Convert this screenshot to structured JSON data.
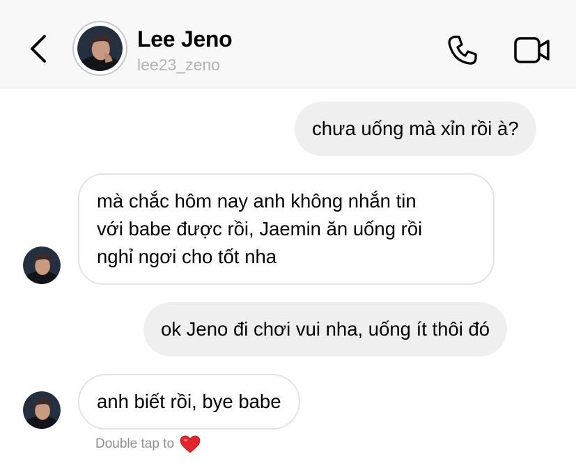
{
  "header": {
    "name": "Lee Jeno",
    "username": "lee23_zeno",
    "icons": [
      "back-icon",
      "phone-icon",
      "video-icon"
    ]
  },
  "messages": [
    {
      "direction": "outgoing",
      "lines": [
        "chưa uống mà xỉn rồi à?"
      ]
    },
    {
      "direction": "incoming",
      "lines": [
        "mà chắc hôm nay anh không nhắn tin",
        "với babe được rồi, Jaemin ăn uống rồi",
        "nghỉ ngơi cho tốt nha"
      ]
    },
    {
      "direction": "outgoing",
      "lines": [
        "ok Jeno đi chơi vui nha, uống ít thôi đó"
      ]
    },
    {
      "direction": "incoming",
      "lines": [
        "anh biết rồi, bye babe"
      ]
    }
  ],
  "hint": {
    "text": "Double tap to",
    "icon": "heart-icon",
    "color": "#e0242f"
  }
}
